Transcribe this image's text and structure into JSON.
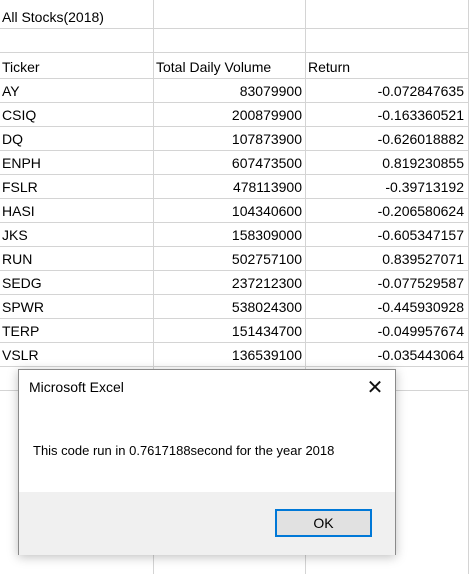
{
  "sheet": {
    "title": "All Stocks(2018)",
    "headers": [
      "Ticker",
      "Total Daily Volume",
      "Return"
    ],
    "rows": [
      {
        "ticker": "AY",
        "volume": "83079900",
        "return": "-0.072847635"
      },
      {
        "ticker": "CSIQ",
        "volume": "200879900",
        "return": "-0.163360521"
      },
      {
        "ticker": "DQ",
        "volume": "107873900",
        "return": "-0.626018882"
      },
      {
        "ticker": "ENPH",
        "volume": "607473500",
        "return": "0.819230855"
      },
      {
        "ticker": "FSLR",
        "volume": "478113900",
        "return": "-0.39713192"
      },
      {
        "ticker": "HASI",
        "volume": "104340600",
        "return": "-0.206580624"
      },
      {
        "ticker": "JKS",
        "volume": "158309000",
        "return": "-0.605347157"
      },
      {
        "ticker": "RUN",
        "volume": "502757100",
        "return": "0.839527071"
      },
      {
        "ticker": "SEDG",
        "volume": "237212300",
        "return": "-0.077529587"
      },
      {
        "ticker": "SPWR",
        "volume": "538024300",
        "return": "-0.445930928"
      },
      {
        "ticker": "TERP",
        "volume": "151434700",
        "return": "-0.049957674"
      },
      {
        "ticker": "VSLR",
        "volume": "136539100",
        "return": "-0.035443064"
      }
    ]
  },
  "dialog": {
    "title": "Microsoft Excel",
    "close_icon": "close-icon",
    "message": "This code run in 0.7617188second for the year 2018",
    "ok_label": "OK"
  },
  "colors": {
    "gridline": "#d4d4d4",
    "dialog_footer": "#f0f0f0",
    "focus_border": "#0078d7"
  }
}
